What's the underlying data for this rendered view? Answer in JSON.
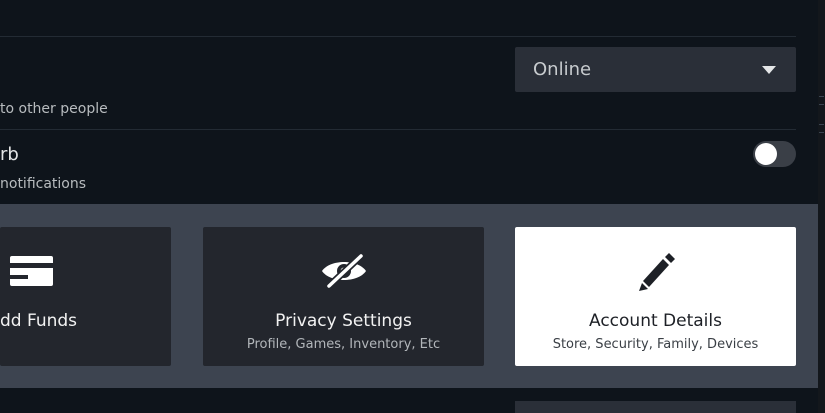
{
  "status": {
    "label_partial": "to other people",
    "dropdown_value": "Online"
  },
  "do_not_disturb": {
    "title_partial": "rb",
    "description_partial": "notifications",
    "enabled": false
  },
  "cards": {
    "add_funds": {
      "title_partial": "dd Funds",
      "icon": "credit-card-icon"
    },
    "privacy": {
      "title": "Privacy Settings",
      "subtitle": "Profile, Games, Inventory, Etc",
      "icon": "eye-slash-icon"
    },
    "account": {
      "title": "Account Details",
      "subtitle": "Store, Security, Family, Devices",
      "icon": "pencil-icon"
    }
  },
  "colors": {
    "background": "#0e141b",
    "band": "#3d4450",
    "card": "#23262d",
    "card_selected": "#ffffff"
  }
}
